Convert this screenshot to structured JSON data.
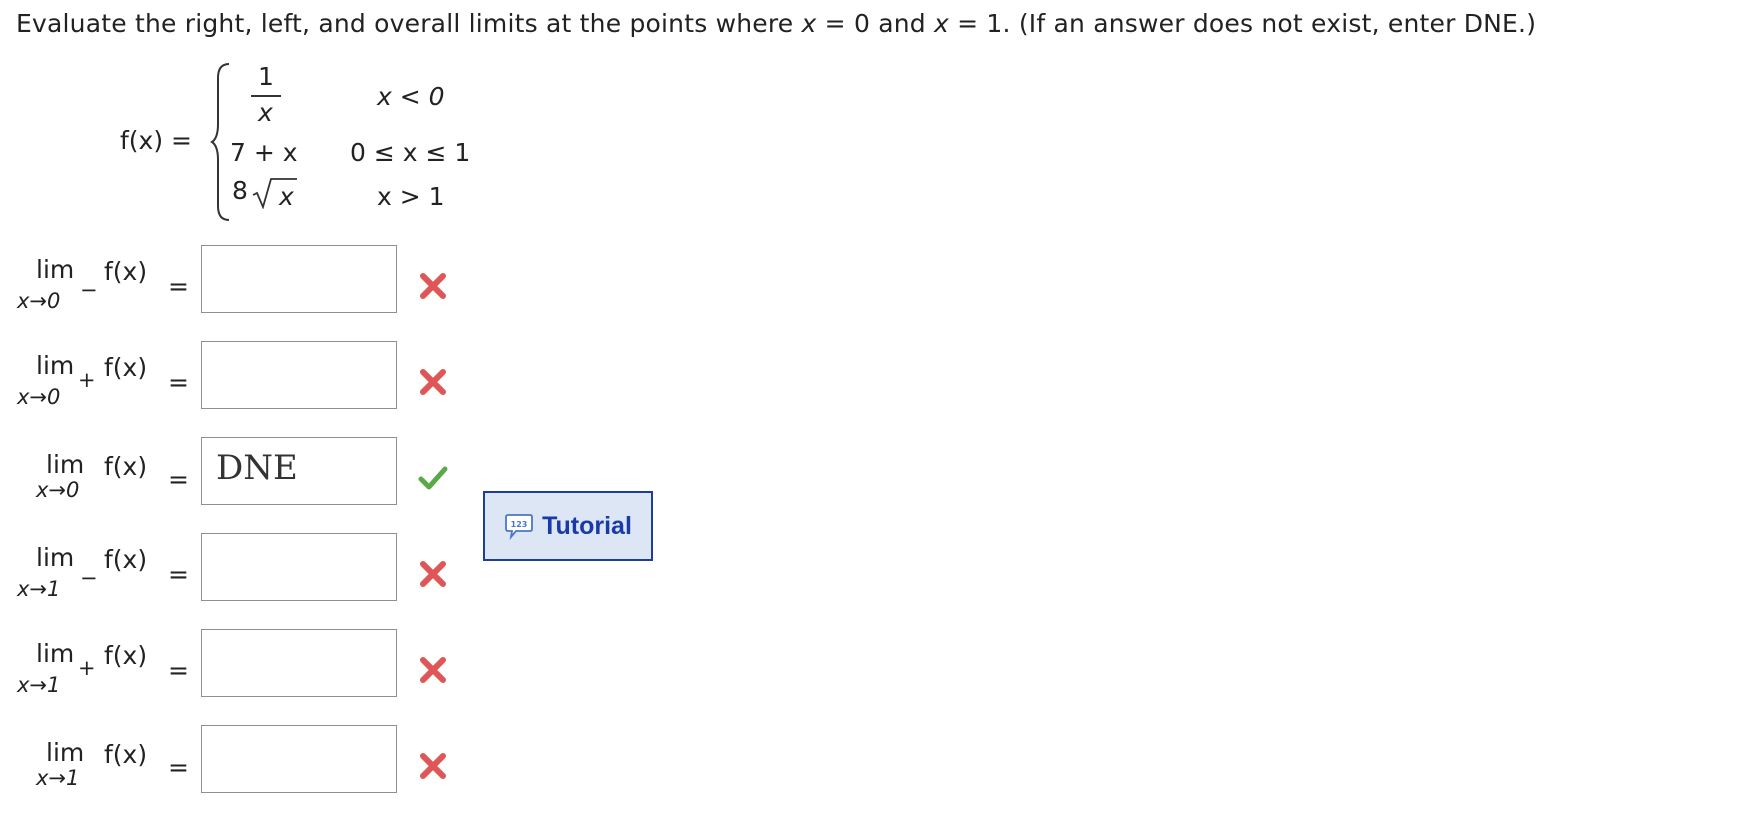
{
  "question": {
    "text_a": "Evaluate the right, left, and overall limits at the points where ",
    "var1": "x",
    "text_b": " = 0 and ",
    "var2": "x",
    "text_c": " = 1. (If an answer does not exist, enter DNE.)"
  },
  "function": {
    "lhs": "f(x)  =",
    "case1": {
      "numerator": "1",
      "denominator": "x",
      "condition": "x < 0"
    },
    "case2": {
      "expression": "7 + x",
      "condition": "0 ≤ x ≤ 1"
    },
    "case3": {
      "coefficient": "8",
      "radicand": "x",
      "condition": "x > 1"
    }
  },
  "limits": [
    {
      "lim": "lim",
      "fx": "f(x)",
      "approach": "x→0",
      "side": "−",
      "eq": "=",
      "value": "",
      "status": "incorrect"
    },
    {
      "lim": "lim",
      "fx": "f(x)",
      "approach": "x→0",
      "side": "+",
      "eq": "=",
      "value": "",
      "status": "incorrect"
    },
    {
      "lim": "lim",
      "fx": "f(x)",
      "approach": "x→0",
      "side": "",
      "eq": "=",
      "value": "DNE",
      "status": "correct"
    },
    {
      "lim": "lim",
      "fx": "f(x)",
      "approach": "x→1",
      "side": "−",
      "eq": "=",
      "value": "",
      "status": "incorrect"
    },
    {
      "lim": "lim",
      "fx": "f(x)",
      "approach": "x→1",
      "side": "+",
      "eq": "=",
      "value": "",
      "status": "incorrect"
    },
    {
      "lim": "lim",
      "fx": "f(x)",
      "approach": "x→1",
      "side": "",
      "eq": "=",
      "value": "",
      "status": "incorrect"
    }
  ],
  "tutorial": {
    "label": "Tutorial",
    "icon": "speech-bubble-123-icon",
    "icon_text": "123"
  },
  "colors": {
    "incorrect": "#e05555",
    "correct": "#5ba84b",
    "tutorial_border": "#1d3f99",
    "tutorial_bg": "#dce6f5"
  }
}
